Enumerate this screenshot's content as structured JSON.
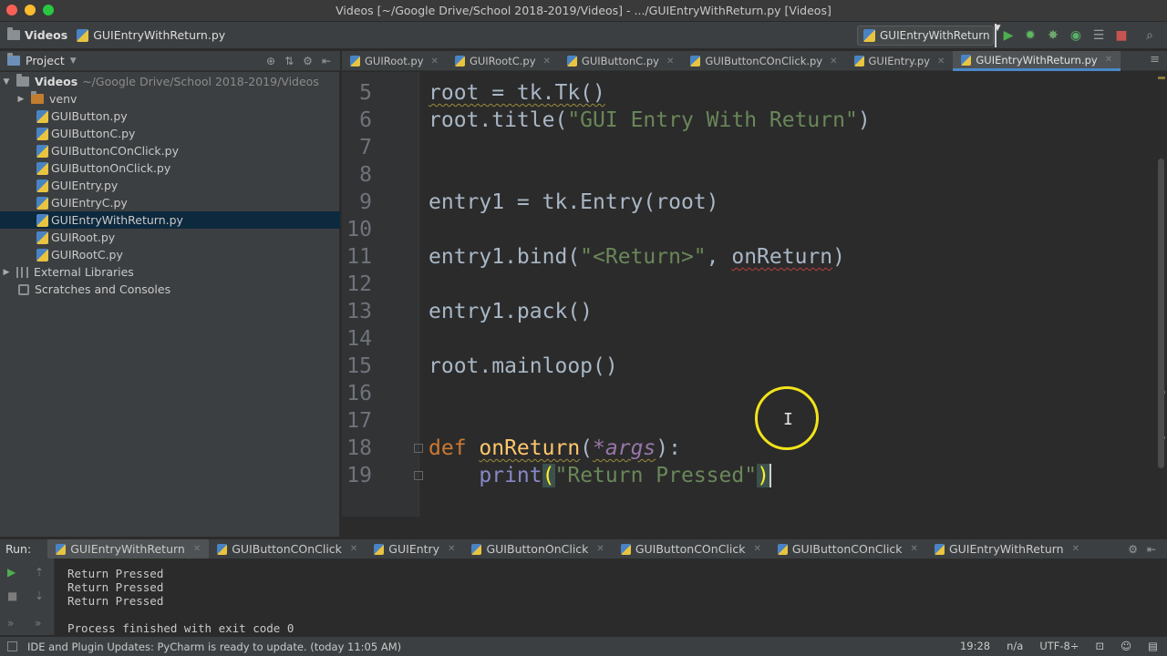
{
  "window": {
    "title": "Videos [~/Google Drive/School 2018-2019/Videos] - .../GUIEntryWithReturn.py [Videos]"
  },
  "navbar": {
    "project": "Videos",
    "file": "GUIEntryWithReturn.py",
    "run_config": "GUIEntryWithReturn"
  },
  "project_panel": {
    "title": "Project",
    "root_name": "Videos",
    "root_path": "~/Google Drive/School 2018-2019/Videos",
    "items": [
      {
        "name": "venv",
        "type": "folder"
      },
      {
        "name": "GUIButton.py",
        "type": "file"
      },
      {
        "name": "GUIButtonC.py",
        "type": "file"
      },
      {
        "name": "GUIButtonCOnClick.py",
        "type": "file"
      },
      {
        "name": "GUIButtonOnClick.py",
        "type": "file"
      },
      {
        "name": "GUIEntry.py",
        "type": "file"
      },
      {
        "name": "GUIEntryC.py",
        "type": "file"
      },
      {
        "name": "GUIEntryWithReturn.py",
        "type": "file",
        "selected": true
      },
      {
        "name": "GUIRoot.py",
        "type": "file"
      },
      {
        "name": "GUIRootC.py",
        "type": "file"
      }
    ],
    "external_libraries": "External Libraries",
    "scratches": "Scratches and Consoles"
  },
  "editor_tabs": [
    {
      "label": "GUIRoot.py"
    },
    {
      "label": "GUIRootC.py"
    },
    {
      "label": "GUIButtonC.py"
    },
    {
      "label": "GUIButtonCOnClick.py"
    },
    {
      "label": "GUIEntry.py"
    },
    {
      "label": "GUIEntryWithReturn.py",
      "active": true
    }
  ],
  "code": {
    "line_numbers": [
      "5",
      "6",
      "7",
      "8",
      "9",
      "10",
      "11",
      "12",
      "13",
      "14",
      "15",
      "16",
      "17",
      "18",
      "19"
    ],
    "l5": "root = tk.Tk()",
    "l6_a": "root.title(",
    "l6_s": "\"GUI Entry With Return\"",
    "l6_b": ")",
    "l9": "entry1 = tk.Entry(root)",
    "l11_a": "entry1.bind(",
    "l11_s": "\"<Return>\"",
    "l11_c": ", ",
    "l11_d": "onReturn",
    "l11_e": ")",
    "l13": "entry1.pack()",
    "l15": "root.mainloop()",
    "l18_k": "def ",
    "l18_f": "onReturn",
    "l18_a": "(",
    "l18_p": "*args",
    "l18_b": "):",
    "l19_i": "    ",
    "l19_f": "print",
    "l19_o": "(",
    "l19_s": "\"Return Pressed\"",
    "l19_c": ")"
  },
  "run_panel": {
    "label": "Run:",
    "tabs": [
      {
        "label": "GUIEntryWithReturn",
        "active": true
      },
      {
        "label": "GUIButtonCOnClick"
      },
      {
        "label": "GUIEntry"
      },
      {
        "label": "GUIButtonOnClick"
      },
      {
        "label": "GUIButtonCOnClick"
      },
      {
        "label": "GUIButtonCOnClick"
      },
      {
        "label": "GUIEntryWithReturn"
      }
    ],
    "console": [
      "Return Pressed",
      "Return Pressed",
      "Return Pressed",
      "",
      "Process finished with exit code 0"
    ]
  },
  "statusbar": {
    "message": "IDE and Plugin Updates: PyCharm is ready to update. (today 11:05 AM)",
    "position": "19:28",
    "line_sep": "n/a",
    "encoding": "UTF-8÷"
  },
  "icons": {
    "run": "play-icon",
    "debug": "bug-icon",
    "settings": "gear-icon"
  },
  "colors": {
    "keyword": "#cc7832",
    "string": "#6a8759",
    "function": "#ffc66d",
    "accent": "#4a88c7"
  }
}
